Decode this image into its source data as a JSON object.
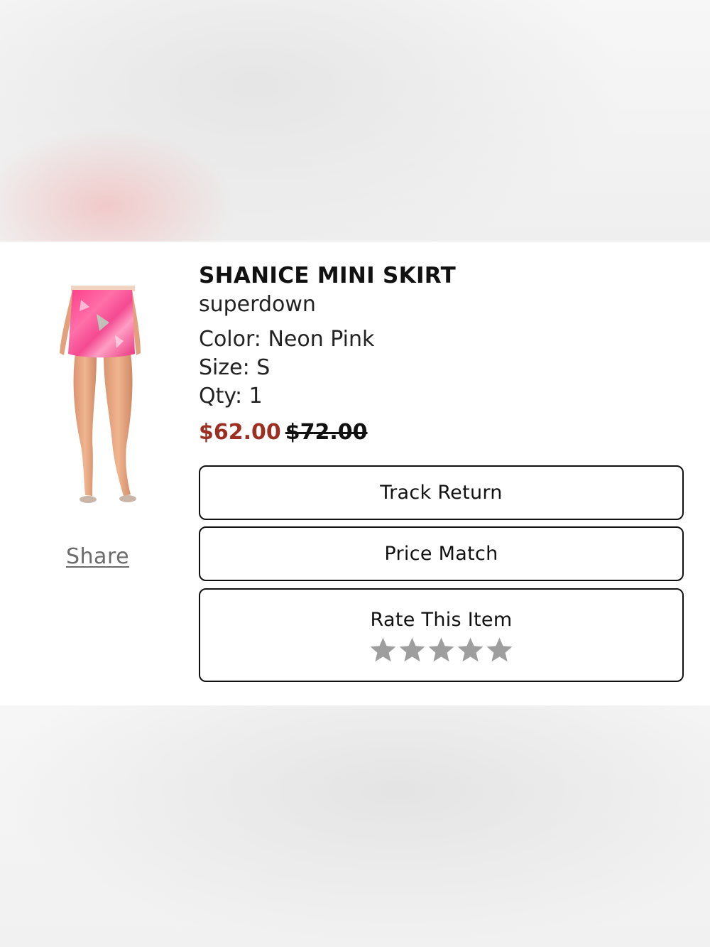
{
  "product": {
    "title": "SHANICE MINI SKIRT",
    "brand": "superdown",
    "color": "Color: Neon Pink",
    "size": "Size: S",
    "qty": "Qty: 1",
    "price_sale": "$62.00",
    "price_original": "$72.00",
    "image_icon": "product-photo-pink-sequin-skirt"
  },
  "actions": {
    "share_label": "Share",
    "track_return_label": "Track Return",
    "price_match_label": "Price Match",
    "rate_label": "Rate This Item"
  },
  "rating": {
    "stars_total": 5,
    "stars_selected": 0,
    "star_icon": "star-icon"
  },
  "colors": {
    "sale_price": "#9c2f22",
    "star_empty": "#9e9e9e",
    "button_border": "#111111"
  }
}
